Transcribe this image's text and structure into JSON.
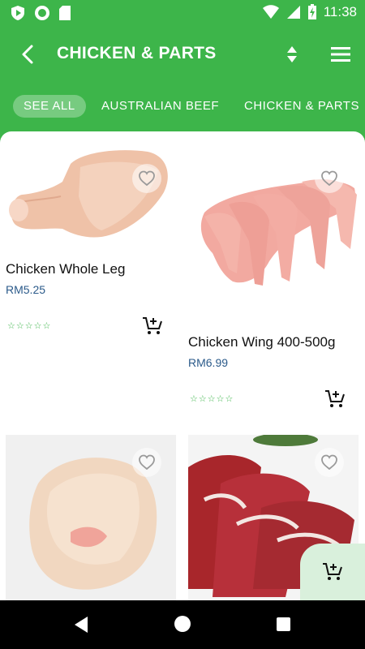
{
  "status_bar": {
    "time": "11:38"
  },
  "header": {
    "title": "CHICKEN & PARTS"
  },
  "tabs": [
    {
      "label": "SEE ALL"
    },
    {
      "label": "AUSTRALIAN BEEF"
    },
    {
      "label": "CHICKEN & PARTS"
    }
  ],
  "products": [
    {
      "name": "Chicken Whole Leg",
      "price": "RM5.25"
    },
    {
      "name": "Chicken Wing 400-500g",
      "price": "RM6.99"
    }
  ],
  "colors": {
    "primary": "#3db54a",
    "fab_bg": "#d9f0dc",
    "price": "#2b5a8a"
  },
  "icons": {
    "back": "back-arrow-icon",
    "sort": "sort-icon",
    "menu": "hamburger-menu-icon",
    "favorite": "heart-outline-icon",
    "cart": "add-to-cart-icon"
  }
}
